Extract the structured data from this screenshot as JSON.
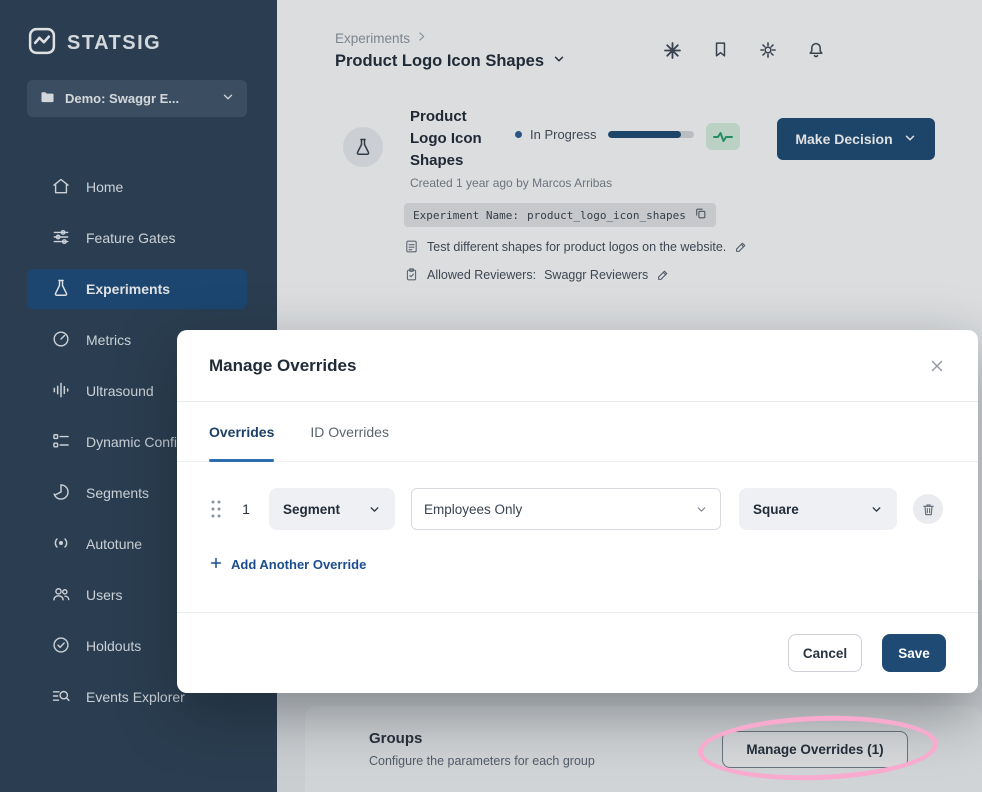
{
  "colors": {
    "accent_navy": "#1e4a74",
    "tab_blue": "#2e6cb2",
    "link_blue": "#1c4d8f",
    "success_green": "#27a06b",
    "annotation_pink": "#f9aacf",
    "sidebar_bg": "#2e4358",
    "sidebar_active_bg": "#1c4c7c"
  },
  "sidebar": {
    "logo_text": "STATSIG",
    "project_selector_label": "Demo: Swaggr E...",
    "items": [
      {
        "label": "Home",
        "icon": "home-icon"
      },
      {
        "label": "Feature Gates",
        "icon": "feature-gates-icon"
      },
      {
        "label": "Experiments",
        "icon": "flask-icon"
      },
      {
        "label": "Metrics",
        "icon": "gauge-icon"
      },
      {
        "label": "Ultrasound",
        "icon": "waveform-icon"
      },
      {
        "label": "Dynamic Config",
        "icon": "config-list-icon"
      },
      {
        "label": "Segments",
        "icon": "segments-icon"
      },
      {
        "label": "Autotune",
        "icon": "autotune-icon"
      },
      {
        "label": "Users",
        "icon": "users-icon"
      },
      {
        "label": "Holdouts",
        "icon": "holdouts-icon"
      },
      {
        "label": "Events Explorer",
        "icon": "events-explorer-icon"
      }
    ]
  },
  "header": {
    "breadcrumb": "Experiments",
    "title": "Product Logo Icon Shapes"
  },
  "experiment": {
    "title": "Product Logo Icon Shapes",
    "status": "In Progress",
    "progress_pct": 84,
    "created": "Created 1 year ago by Marcos Arribas",
    "name_label": "Experiment Name:",
    "name_value": "product_logo_icon_shapes",
    "hypothesis": "Test different shapes for product logos on the website.",
    "reviewers_label": "Allowed Reviewers:",
    "reviewers_value": "Swaggr Reviewers",
    "make_decision": "Make Decision"
  },
  "groups": {
    "title": "Groups",
    "subtitle": "Configure the parameters for each group",
    "manage_overrides": "Manage Overrides (1)"
  },
  "modal": {
    "title": "Manage Overrides",
    "tab_overrides": "Overrides",
    "tab_id_overrides": "ID Overrides",
    "row": {
      "index": "1",
      "type": "Segment",
      "target": "Employees Only",
      "group": "Square"
    },
    "add_override": "Add Another Override",
    "cancel": "Cancel",
    "save": "Save"
  }
}
